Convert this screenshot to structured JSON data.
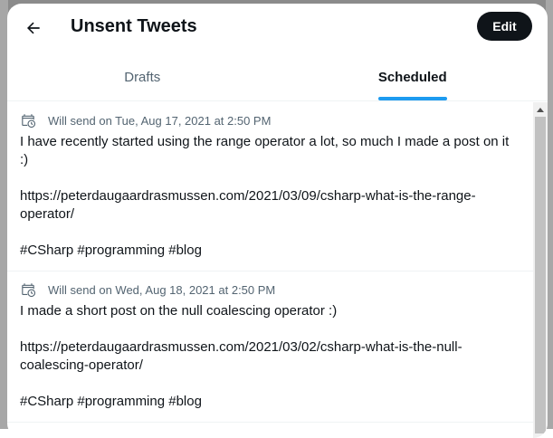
{
  "header": {
    "title": "Unsent Tweets",
    "back_icon": "arrow-left-icon",
    "edit_label": "Edit"
  },
  "tabs": [
    {
      "label": "Drafts",
      "active": false
    },
    {
      "label": "Scheduled",
      "active": true
    }
  ],
  "colors": {
    "accent": "#1d9bf0",
    "text_primary": "#0f1419",
    "text_secondary": "#536471",
    "edit_button_bg": "#0f1419"
  },
  "scheduled": [
    {
      "icon": "calendar-clock-icon",
      "when": "Will send on Tue, Aug 17, 2021 at 2:50 PM",
      "lines": [
        "I have recently started using the range operator a lot, so much I made a post on it",
        ":)",
        "",
        "https://peterdaugaardrasmussen.com/2021/03/09/csharp-what-is-the-range-",
        "operator/",
        "",
        "#CSharp #programming #blog"
      ]
    },
    {
      "icon": "calendar-clock-icon",
      "when": "Will send on Wed, Aug 18, 2021 at 2:50 PM",
      "lines": [
        "I made a short post on the null coalescing operator :)",
        "",
        "https://peterdaugaardrasmussen.com/2021/03/02/csharp-what-is-the-null-",
        "coalescing-operator/",
        "",
        "#CSharp #programming #blog"
      ]
    }
  ]
}
